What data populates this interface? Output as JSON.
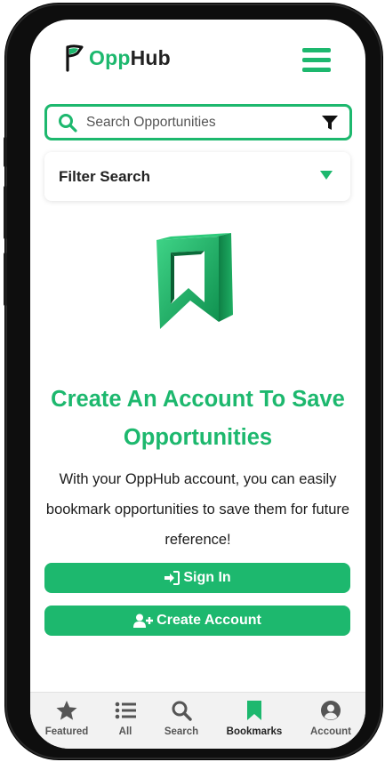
{
  "app": {
    "brand_prefix": "Opp",
    "brand_suffix": "Hub",
    "brand_color": "#1db86e"
  },
  "search": {
    "placeholder": "Search Opportunities"
  },
  "filter": {
    "label": "Filter Search"
  },
  "empty_state": {
    "title": "Create An Account To Save Opportunities",
    "body": "With your OppHub account, you can easily bookmark opportunities to save them for future reference!"
  },
  "actions": {
    "sign_in": "Sign In",
    "create_account": "Create Account"
  },
  "nav": {
    "items": [
      {
        "label": "Featured",
        "icon": "star-icon"
      },
      {
        "label": "All",
        "icon": "list-icon"
      },
      {
        "label": "Search",
        "icon": "search-icon"
      },
      {
        "label": "Bookmarks",
        "icon": "bookmark-icon",
        "active": true
      },
      {
        "label": "Account",
        "icon": "user-circle-icon"
      }
    ]
  }
}
